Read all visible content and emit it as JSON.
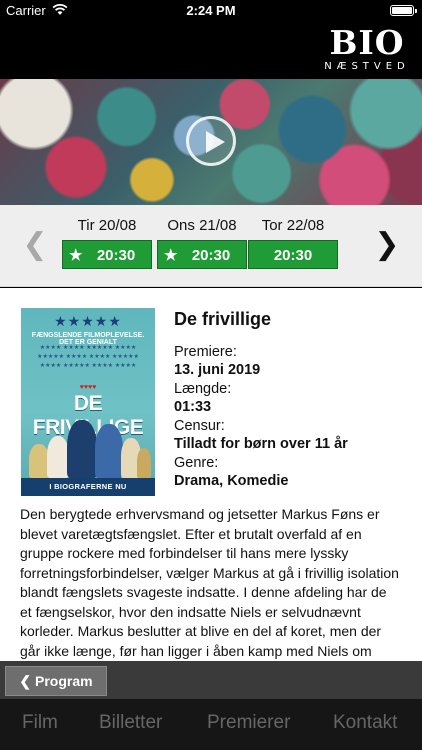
{
  "status_bar": {
    "carrier": "Carrier",
    "time": "2:24 PM"
  },
  "logo": {
    "main": "BIO",
    "sub": "NÆSTVED"
  },
  "hero": {
    "play_icon": "play-icon"
  },
  "schedule": {
    "prev_arrow": "❮",
    "next_arrow": "❯",
    "days": [
      {
        "label": "Tir 20/08",
        "time": "20:30",
        "star": "★"
      },
      {
        "label": "Ons 21/08",
        "time": "20:30",
        "star": "★"
      },
      {
        "label": "Tor 22/08",
        "time": "20:30",
        "star": ""
      }
    ]
  },
  "film": {
    "title": "De frivillige",
    "premiere_label": "Premiere:",
    "premiere_value": "13. juni 2019",
    "length_label": "Længde:",
    "length_value": "01:33",
    "censor_label": "Censur:",
    "censor_value": "Tilladt for børn over 11 år",
    "genre_label": "Genre:",
    "genre_value": "Drama, Komedie",
    "description": "Den berygtede erhvervsmand og jetsetter Markus Føns er blevet varetægtsfængslet. Efter et brutalt overfald af en gruppe rockere med forbindelser til hans mere lyssky forretningsforbindelser, vælger Markus at gå i frivillig isolation blandt fængslets svageste indsatte. I denne afdeling har de et fængselskor, hvor den indsatte Niels er selvudnævnt korleder. Markus beslutter at blive en del af koret, men der går ikke længe, før han ligger i åben kamp med Niels om pladsen i toppen af hierarkiet. Det er ikke en",
    "poster": {
      "stars": "★★★★★",
      "quote": "FÆNGSLENDE FILMOPLEVELSE. DET ER GENIALT",
      "mini_stars": "★★★★ ★★★★ ★★★★★ ★★★★ ★★★★★ ★★★★ ★★★★ ★★★★★ ★★★★ ★★★★★ ★★★★ ★★★★",
      "hearts": "♥♥♥♥",
      "title": "DE FRIVILLIGE",
      "banner": "I BIOGRAFERNE NU"
    }
  },
  "program_button": "❮ Program",
  "tabs": [
    "Film",
    "Billetter",
    "Premierer",
    "Kontakt"
  ]
}
